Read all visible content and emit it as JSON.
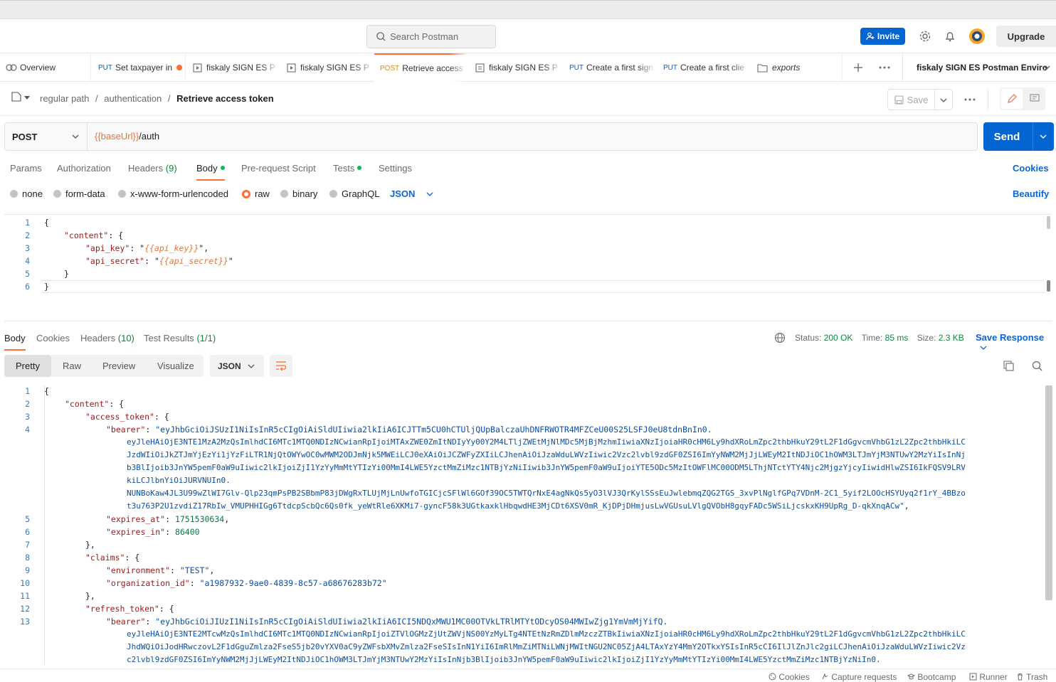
{
  "header": {
    "search_placeholder": "Search Postman",
    "invite_label": "Invite",
    "upgrade_label": "Upgrade"
  },
  "tabs": [
    {
      "label": "Overview",
      "method": ""
    },
    {
      "label": "Set taxpayer in",
      "method": "PUT"
    },
    {
      "label": "fiskaly SIGN ES P",
      "method": ""
    },
    {
      "label": "fiskaly SIGN ES P",
      "method": ""
    },
    {
      "label": "Retrieve access",
      "method": "POST"
    },
    {
      "label": "fiskaly SIGN ES P",
      "method": ""
    },
    {
      "label": "Create a first sign",
      "method": "PUT"
    },
    {
      "label": "Create a first clie",
      "method": "PUT"
    },
    {
      "label": "exports",
      "method": ""
    }
  ],
  "environment": "fiskaly SIGN ES Postman Enviro",
  "breadcrumb": {
    "part1": "regular path",
    "part2": "authentication",
    "current": "Retrieve access token"
  },
  "toolbar": {
    "save_label": "Save"
  },
  "request": {
    "method": "POST",
    "url_var": "{{baseUrl}}",
    "url_path": "/auth",
    "send_label": "Send"
  },
  "request_tabs": {
    "params": "Params",
    "authorization": "Authorization",
    "headers": "Headers",
    "headers_count": "(9)",
    "body": "Body",
    "prerequest": "Pre-request Script",
    "tests": "Tests",
    "settings": "Settings",
    "cookies": "Cookies"
  },
  "body_types": {
    "none": "none",
    "form_data": "form-data",
    "urlencoded": "x-www-form-urlencoded",
    "raw": "raw",
    "binary": "binary",
    "graphql": "GraphQL",
    "format": "JSON",
    "beautify": "Beautify"
  },
  "request_body": {
    "key_content": "\"content\"",
    "key_api_key": "\"api_key\"",
    "val_api_key": "{{api_key}}",
    "key_api_secret": "\"api_secret\"",
    "val_api_secret": "{{api_secret}}"
  },
  "response_tabs": {
    "body": "Body",
    "cookies": "Cookies",
    "headers": "Headers",
    "headers_count": "(10)",
    "tests": "Test Results",
    "tests_count": "(1/1)"
  },
  "response_info": {
    "status_label": "Status:",
    "status": "200 OK",
    "time_label": "Time:",
    "time": "85 ms",
    "size_label": "Size:",
    "size": "2.3 KB",
    "save_response": "Save Response"
  },
  "view_modes": {
    "pretty": "Pretty",
    "raw": "Raw",
    "preview": "Preview",
    "visualize": "Visualize",
    "format": "JSON"
  },
  "response_body": {
    "key_content": "\"content\"",
    "key_access_token": "\"access_token\"",
    "key_bearer": "\"bearer\"",
    "bearer_1": "\"eyJhbGciOiJSUzI1NiIsInR5cCIgOiAiSldUIiwia2lkIiA6ICJTTm5CU0hCTUljQUpBalczaUhDNFRWOTR4MFZCeU00S25LSFJ0eU8tdnBnIn0.",
    "bearer_2": "eyJleHAiOjE3NTE1MzA2MzQsImlhdCI6MTc1MTQ0NDIzNCwianRpIjoiMTAxZWE0ZmItNDIyYy00Y2M4LTljZWEtMjNlMDc5MjBjMzhmIiwiaXNzIjoiaHR0cHM6Ly9hdXRoLmZpc2thbHkuY29tL2F1dGgvcmVhbG1zL2Zpc2thbHkiLC",
    "bearer_3": "JzdWIiOiJkZTJmYjEzYi1jYzFiLTR1NjQtOWYwOC0wMWM2ODJmNjk5MWEiLCJ0eXAiOiJCZWFyZXIiLCJhenAiOiJzaWduLWVzIiwic2Vzc2lvbl9zdGF0ZSI6ImYyNWM2MjJjLWEyM2ItNDJiOC1hOWM3LTJmYjM3NTUwY2MzYiIsInNj",
    "bearer_4": "b3BlIjoib3JnYW5pemF0aW9uIiwic2lkIjoiZjI1YzYyMmMtYTIzYi00MmI4LWE5YzctMmZiMzc1NTBjYzNiIiwib3JnYW5pemF0aW9uIjoiYTE5ODc5MzItOWFlMC00ODM5LThjNTctYTY4Njc2MjgzYjcyIiwidHlwZSI6IkFQSV9LRV",
    "bearer_5": "kiLCJlbnYiOiJURVNUIn0.",
    "bearer_6": "NUNBoKaw4JL3U99wZlWI7Glv-Qlp23qmPsPB2SBbmP83jDWgRxTLUjMjLnUwfoTGICjcSFlWl6GOf39OC5TWTQrNxE4agNkQs5yO3lVJ3QrKylSSsEuJwlebmqZQG2TGS_3xvPlNglfGPq7VDnM-2C1_5yif2LOOcHSYUyq2f1rY_4BBzo",
    "bearer_7": "t3u763P2U1zvdiZ17RbIw_VMUPHHIGg6TtdcpScbQc6Qs0fk_yeWtRle6XKMi7-gyncF58k3UGtkaxklHbqwdHE3MjCDt6XSV0mR_KjDPjDHmjusLwVGUsuLVlgQVObH8gqyFADc5WSiLjcskxKH9UpRg_D-qkXnqACw\"",
    "key_expires_at": "\"expires_at\"",
    "val_expires_at": "1751530634",
    "key_expires_in": "\"expires_in\"",
    "val_expires_in": "86400",
    "key_claims": "\"claims\"",
    "key_environment": "\"environment\"",
    "val_environment": "\"TEST\"",
    "key_org": "\"organization_id\"",
    "val_org": "\"a1987932-9ae0-4839-8c57-a68676283b72\"",
    "key_refresh": "\"refresh_token\"",
    "refresh_1": "\"eyJhbGciOiJIUzI1NiIsInR5cCIgOiAiSldUIiwia2lkIiA6ICI5NDQxMWU1MC00OTVkLTRlMTYtODcyOS04MWIwZjg1YmVmMjYifQ.",
    "refresh_2": "eyJleHAiOjE3NTE2MTcwMzQsImlhdCI6MTc1MTQ0NDIzNCwianRpIjoiZTVlOGMzZjUtZWVjNS00YzMyLTg4NTEtNzRmZDlmMzczZTBkIiwiaXNzIjoiaHR0cHM6Ly9hdXRoLmZpc2thbHkuY29tL2F1dGgvcmVhbG1zL2Zpc2thbHkiLC",
    "refresh_3": "JhdWQiOiJodHRwczovL2F1dGguZmlza2FseS5jb20vYXV0aC9yZWFsbXMvZmlza2FseSIsInN1YiI6ImRlMmZiMTNiLWNjMWItNGU2NC05ZjA4LTAxYzY4MmY2OTkxYSIsInR5cCI6IlJlZnJlc2giLCJhenAiOiJzaWduLWVzIiwic2Vz",
    "refresh_4": "c2lvbl9zdGF0ZSI6ImYyNWM2MjJjLWEyM2ItNDJiOC1hOWM3LTJmYjM3NTUwY2MzYiIsInNjb3BlIjoib3JnYW5pemF0aW9uIiwic2lkIjoiZjI1YzYyMmMtYTIzYi00MmI4LWE5YzctMmZiMzc1NTBjYzNiIn0."
  },
  "statusbar": {
    "cookies": "Cookies",
    "capture": "Capture requests",
    "bootcamp": "Bootcamp",
    "runner": "Runner",
    "trash": "Trash"
  },
  "colors": {
    "accent": "#ff6c37",
    "primary": "#0265d2",
    "put": "#0b5cc7",
    "post": "#e28b1a"
  }
}
